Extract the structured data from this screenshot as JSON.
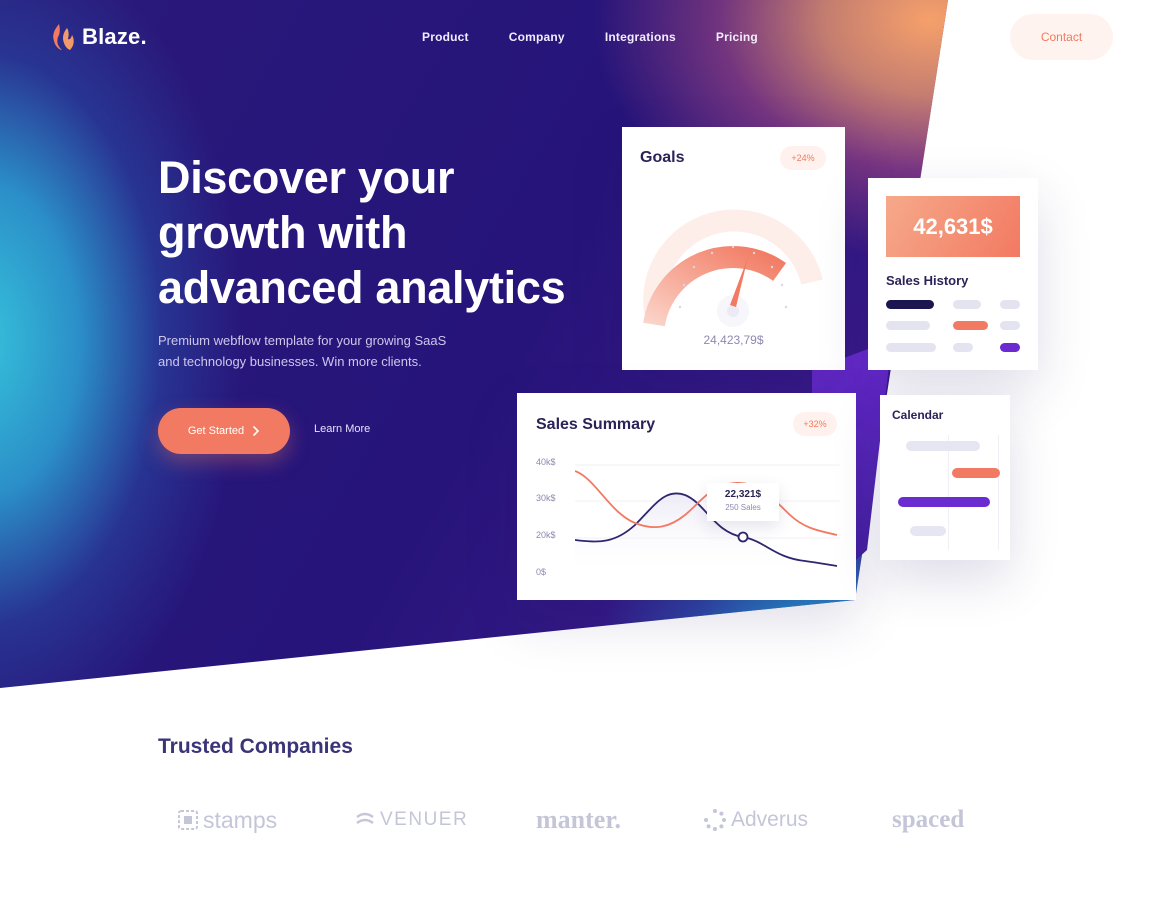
{
  "nav": {
    "brand": "Blaze.",
    "links": [
      "Product",
      "Company",
      "Integrations",
      "Pricing"
    ],
    "contact_label": "Contact"
  },
  "hero": {
    "title_lines": [
      "Discover your",
      "growth with",
      "advanced analytics"
    ],
    "subtitle_lines": [
      "Premium webflow template for your growing SaaS",
      "and technology businesses. Win more clients."
    ],
    "cta_label": "Get Started",
    "secondary_label": "Learn More"
  },
  "goals_card": {
    "title": "Goals",
    "badge": "+24%",
    "value": "24,423,79$",
    "progress": 0.62
  },
  "history_card": {
    "amount": "42,631$",
    "title": "Sales History"
  },
  "summary_card": {
    "title": "Sales Summary",
    "badge": "+32%",
    "y_labels": [
      "40k$",
      "30k$",
      "20k$",
      "0$"
    ],
    "tooltip_value": "22,321$",
    "tooltip_sub": "250 Sales"
  },
  "calendar_card": {
    "title": "Calendar"
  },
  "trusted": {
    "heading": "Trusted Companies",
    "companies": [
      "stamps",
      "VENUER",
      "manter.",
      "Adverus",
      "spaced"
    ]
  },
  "colors": {
    "accent": "#f27a62",
    "navy": "#2a2357",
    "purple": "#6a2bd0"
  }
}
